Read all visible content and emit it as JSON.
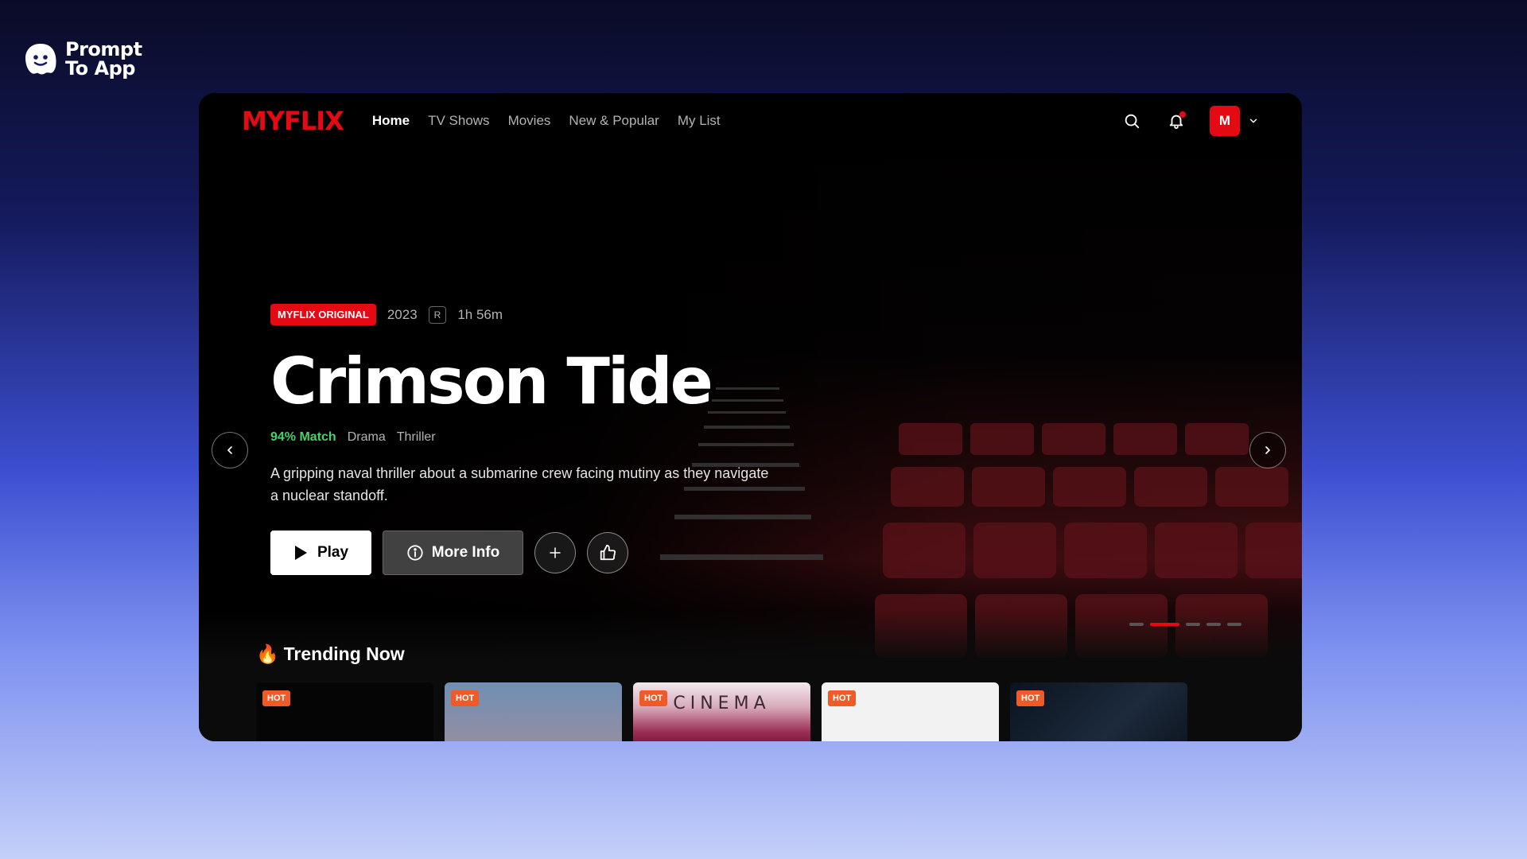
{
  "brand": {
    "line1": "Prompt",
    "line2": "To App"
  },
  "nav": {
    "logo": "MYFLIX",
    "links": [
      "Home",
      "TV Shows",
      "Movies",
      "New & Popular",
      "My List"
    ],
    "active": "Home",
    "avatar_letter": "M"
  },
  "hero": {
    "badge": "MYFLIX ORIGINAL",
    "year": "2023",
    "rating": "R",
    "duration": "1h 56m",
    "title": "Crimson Tide",
    "match": "94% Match",
    "genres": [
      "Drama",
      "Thriller"
    ],
    "description": "A gripping naval thriller about a submarine crew facing mutiny as they navigate a nuclear standoff.",
    "play_label": "Play",
    "info_label": "More Info"
  },
  "carousel": {
    "total": 5,
    "active_index": 1
  },
  "trending": {
    "title": "Trending Now",
    "icon": "fire-icon",
    "cards": [
      {
        "badge": "HOT"
      },
      {
        "badge": "HOT"
      },
      {
        "badge": "HOT",
        "text": "CINEMA"
      },
      {
        "badge": "HOT"
      },
      {
        "badge": "HOT"
      }
    ]
  },
  "colors": {
    "accent": "#e50914",
    "match": "#46d369",
    "hot": "#f05a28"
  }
}
